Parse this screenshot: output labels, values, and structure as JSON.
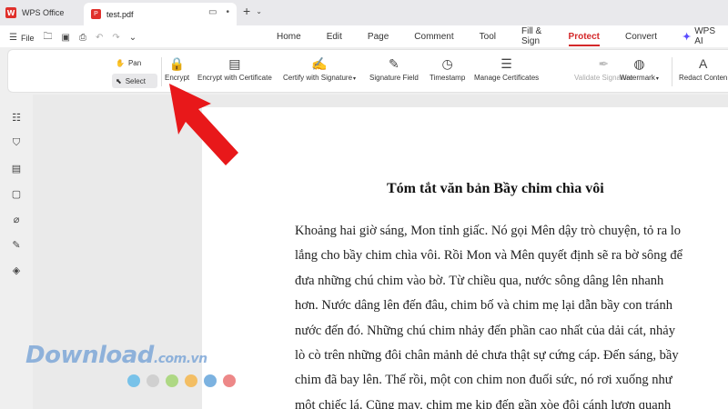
{
  "tabbar": {
    "app_label": "WPS Office",
    "doc_tab_label": "test.pdf",
    "new_tab_symbol": "+"
  },
  "menu": {
    "file_label": "File",
    "tabs": [
      {
        "label": "Home"
      },
      {
        "label": "Edit"
      },
      {
        "label": "Page"
      },
      {
        "label": "Comment"
      },
      {
        "label": "Tool"
      },
      {
        "label": "Fill & Sign"
      },
      {
        "label": "Protect"
      },
      {
        "label": "Convert"
      }
    ],
    "ai_label": "WPS AI",
    "active_tab": "Protect"
  },
  "ribbon": {
    "pan_label": "Pan",
    "select_label": "Select",
    "buttons": [
      {
        "label": "Encrypt",
        "icon": "lock-file-icon",
        "disabled": false,
        "caret": false
      },
      {
        "label": "Encrypt with Certificate",
        "icon": "certificate-file-icon",
        "disabled": false,
        "caret": false
      },
      {
        "label": "Certify with Signature",
        "icon": "signature-file-icon",
        "disabled": false,
        "caret": true
      },
      {
        "label": "Signature Field",
        "icon": "signature-field-icon",
        "disabled": false,
        "caret": false
      },
      {
        "label": "Timestamp",
        "icon": "timestamp-icon",
        "disabled": false,
        "caret": false
      },
      {
        "label": "Manage Certificates",
        "icon": "sliders-icon",
        "disabled": false,
        "caret": false
      },
      {
        "label": "Validate Signature",
        "icon": "validate-pen-icon",
        "disabled": true,
        "caret": false
      },
      {
        "label": "Watermark",
        "icon": "watermark-icon",
        "disabled": false,
        "caret": true
      },
      {
        "label": "Redact Conten",
        "icon": "redact-text-icon",
        "disabled": false,
        "caret": false
      }
    ]
  },
  "document": {
    "title": "Tóm tắt văn bản Bầy chim chìa vôi",
    "lines": [
      "Khoảng hai giờ sáng, Mon tỉnh giấc. Nó gọi Mên dậy trò chuyện, tỏ ra lo",
      "lắng cho bầy chim chìa vôi. Rồi Mon và Mên quyết định sẽ ra bờ sông để",
      "đưa những chú chim vào bờ. Từ chiều qua, nước sông dâng lên nhanh",
      "hơn. Nước dâng lên đến đâu, chim bố và chim mẹ lại dẫn bầy con tránh",
      "nước đến đó. Những chú chim nhảy đến phần cao nhất của dải cát, nhảy",
      "lò cò trên những đôi chân mảnh dẻ chưa thật sự cứng cáp. Đến sáng, bầy",
      "chim đã bay lên. Thế rồi, một con chim non đuối sức, nó rơi xuống như",
      "một chiếc lá. Cũng may, chim mẹ kịp đến gần xòe đôi cánh lượn quanh"
    ]
  },
  "watermark": {
    "text_main": "Download",
    "text_small": ".com.vn",
    "dot_colors": [
      "#5bb8e8",
      "#c9c9c9",
      "#9fd36a",
      "#f5b342",
      "#5b9fd8",
      "#e86a6a"
    ]
  },
  "colors": {
    "accent": "#d4282a",
    "arrow": "#e8181a"
  }
}
